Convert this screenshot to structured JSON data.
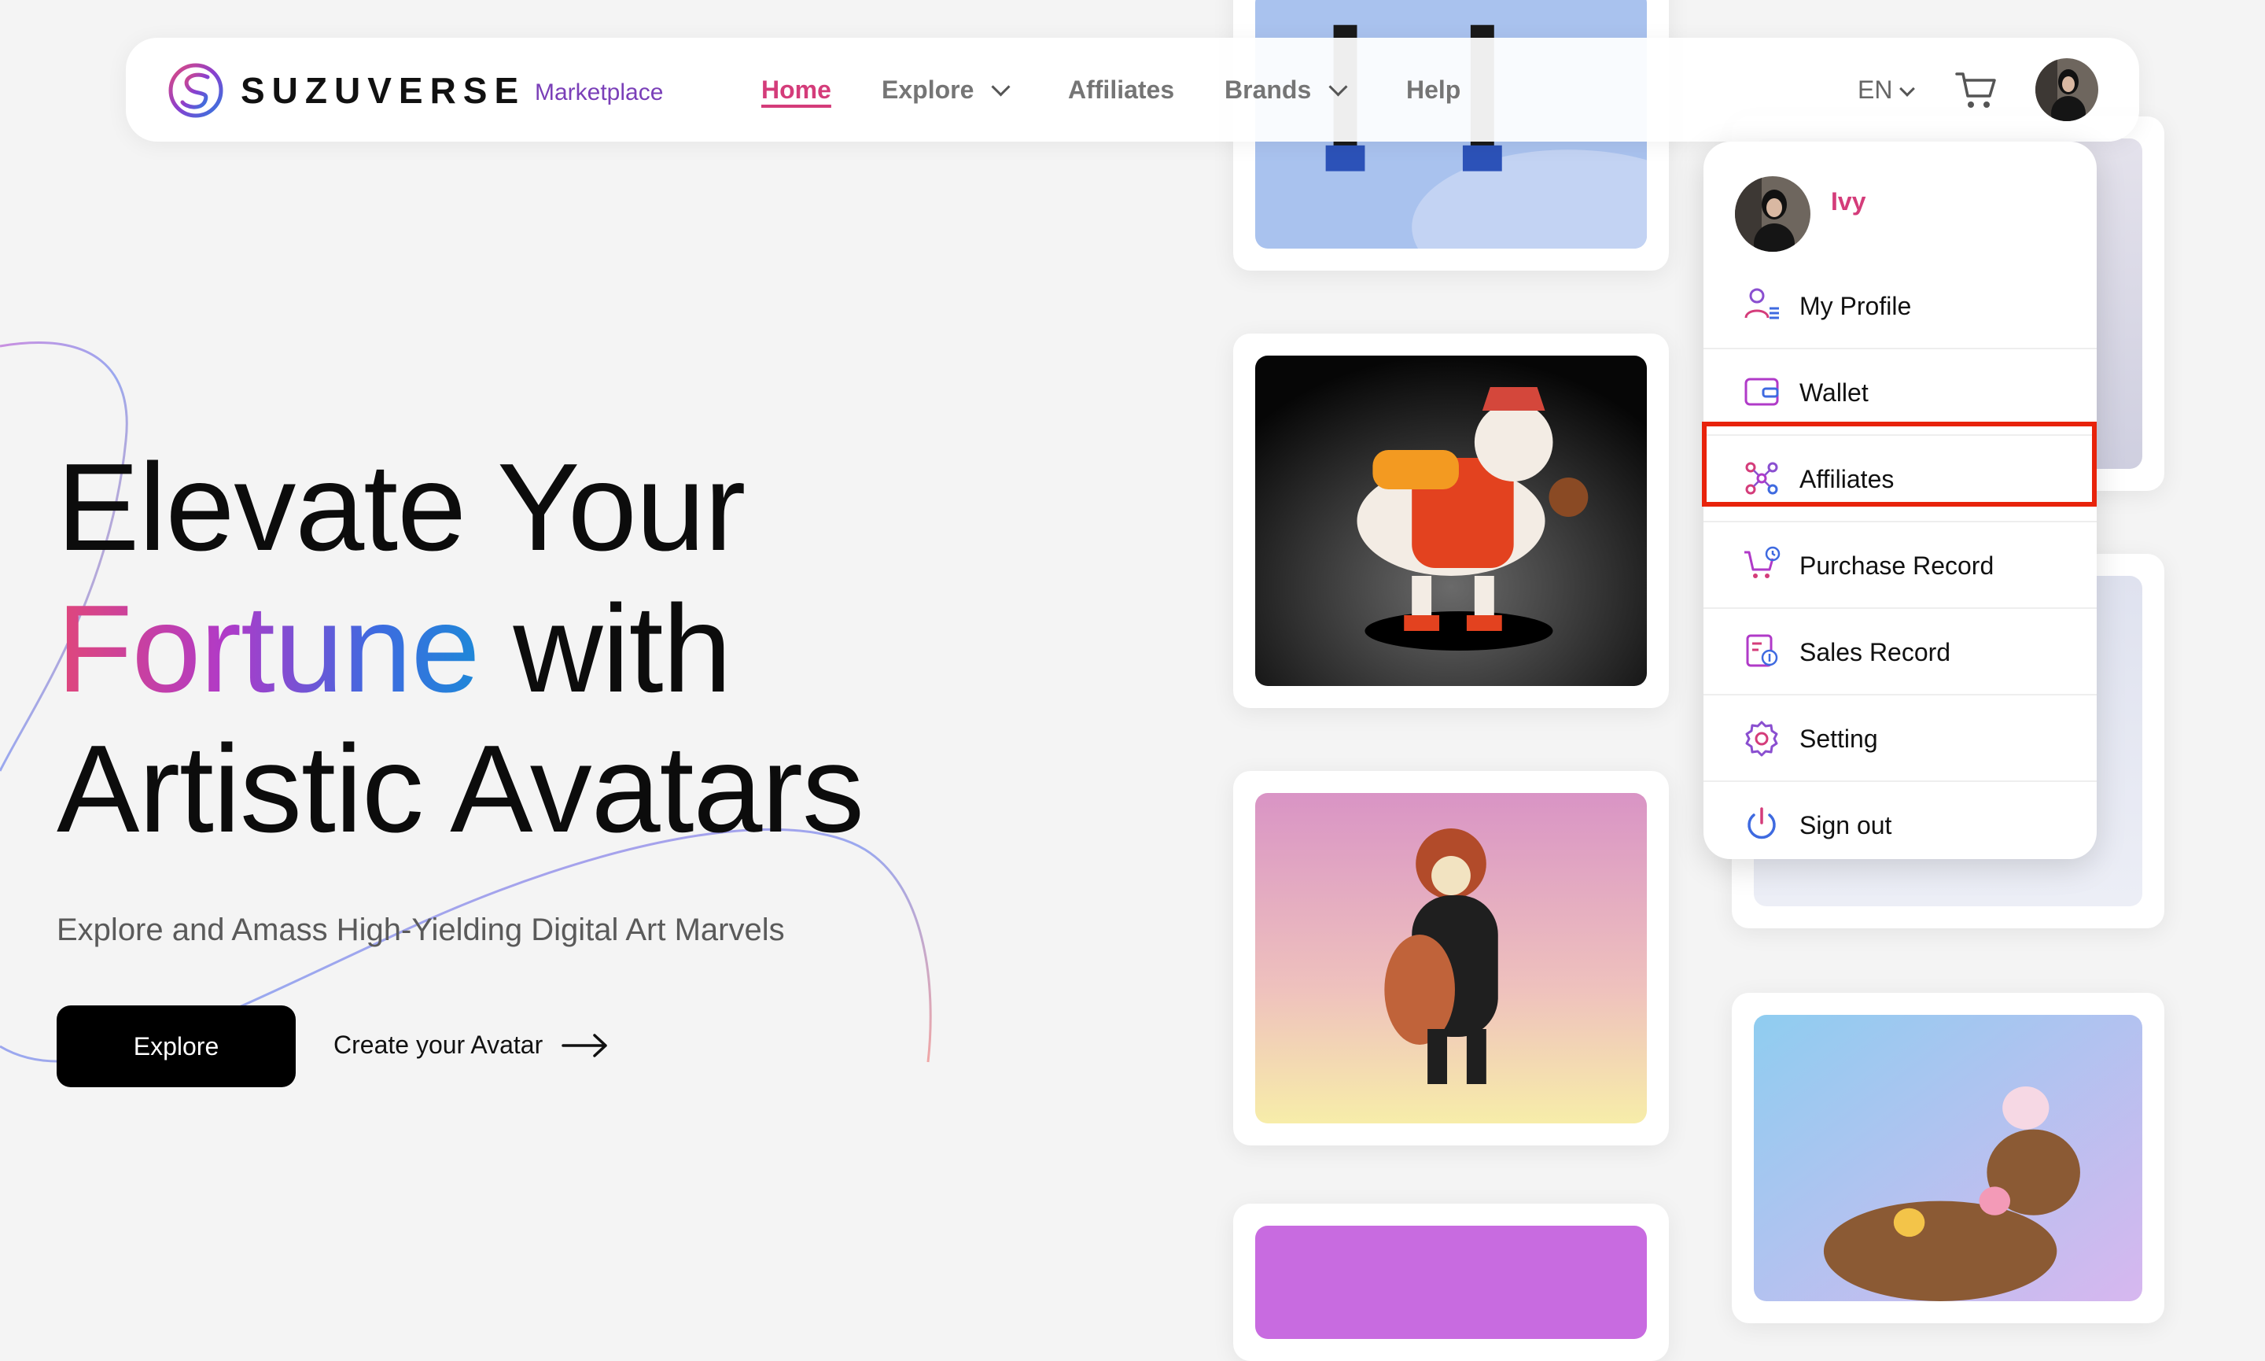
{
  "nav": {
    "brand": "SUZUVERSE",
    "brand_sub": "Marketplace",
    "items": [
      "Home",
      "Explore",
      "Affiliates",
      "Brands",
      "Help"
    ],
    "lang": "EN"
  },
  "hero": {
    "line1": "Elevate Your",
    "line2_highlight": "Fortune",
    "line2_rest": " with",
    "line3": "Artistic Avatars",
    "subtitle": "Explore and Amass High-Yielding Digital Art Marvels",
    "cta_primary": "Explore",
    "cta_secondary": "Create your Avatar"
  },
  "user_menu": {
    "username": "Ivy",
    "items": [
      {
        "label": "My Profile",
        "icon": "profile-icon"
      },
      {
        "label": "Wallet",
        "icon": "wallet-icon"
      },
      {
        "label": "Affiliates",
        "icon": "affiliates-icon"
      },
      {
        "label": "Purchase Record",
        "icon": "purchase-record-icon"
      },
      {
        "label": "Sales Record",
        "icon": "sales-record-icon"
      },
      {
        "label": "Setting",
        "icon": "setting-icon"
      },
      {
        "label": "Sign out",
        "icon": "sign-out-icon"
      }
    ],
    "highlighted": "Affiliates"
  },
  "colors": {
    "accent_pink": "#d43c7a",
    "gradient": [
      "#e0477a",
      "#b03ac8",
      "#3e6ae0",
      "#1e88d8"
    ],
    "highlight_box": "#e8230b",
    "button_bg": "#000000"
  }
}
